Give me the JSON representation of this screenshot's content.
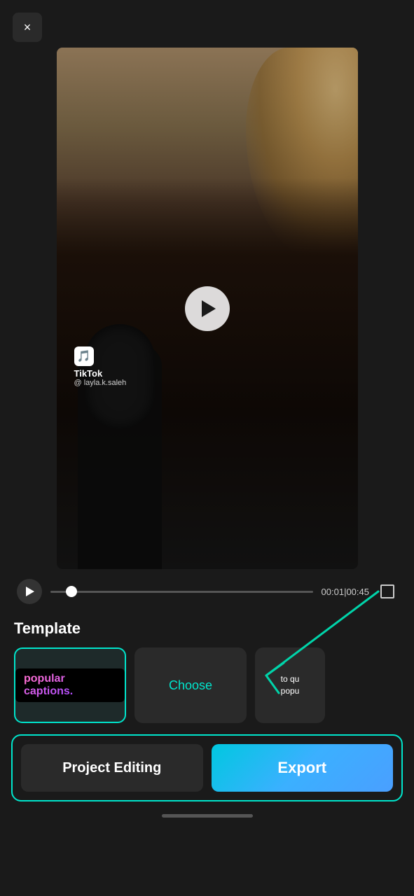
{
  "app": {
    "background": "#1a1a1a"
  },
  "close_button": {
    "label": "×"
  },
  "video": {
    "tiktok_username": "TikTok",
    "tiktok_handle": "@ layla.k.saleh",
    "time_current": "00:01",
    "time_total": "00:45"
  },
  "template": {
    "label": "Template",
    "card1_text": "popular captions.",
    "card2_text": "Choose",
    "card3_line1": "to qu",
    "card3_line2": "popu"
  },
  "actions": {
    "project_editing_label": "Project Editing",
    "export_label": "Export"
  }
}
